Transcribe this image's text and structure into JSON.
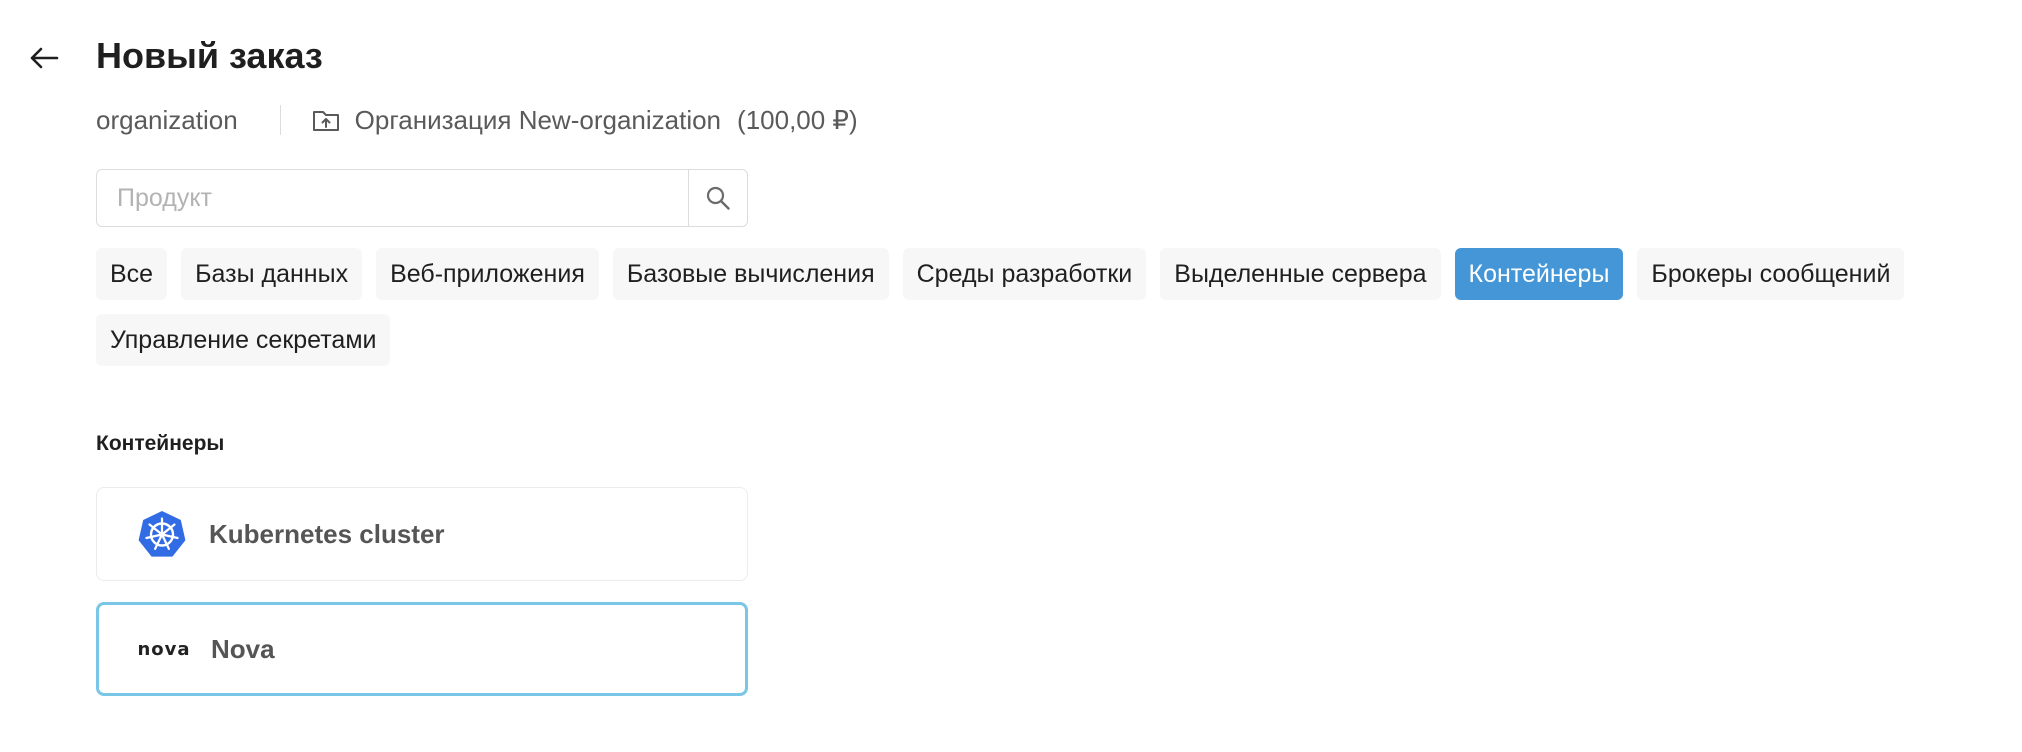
{
  "header": {
    "title": "Новый заказ",
    "back_icon": "arrow-left-icon"
  },
  "context": {
    "scope": "organization",
    "org_icon": "folder-upload-icon",
    "org_name": "Организация New-organization",
    "balance": "(100,00 ₽)"
  },
  "search": {
    "placeholder": "Продукт",
    "value": "",
    "icon": "search-icon"
  },
  "categories": [
    {
      "label": "Все",
      "active": false
    },
    {
      "label": "Базы данных",
      "active": false
    },
    {
      "label": "Веб-приложения",
      "active": false
    },
    {
      "label": "Базовые вычисления",
      "active": false
    },
    {
      "label": "Среды разработки",
      "active": false
    },
    {
      "label": "Выделенные сервера",
      "active": false
    },
    {
      "label": "Контейнеры",
      "active": true
    },
    {
      "label": "Брокеры сообщений",
      "active": false
    },
    {
      "label": "Управление секретами",
      "active": false
    }
  ],
  "section": {
    "title": "Контейнеры",
    "products": [
      {
        "name": "Kubernetes cluster",
        "icon": "kubernetes-icon"
      },
      {
        "name": "Nova",
        "logo_text": "nova",
        "icon": "nova-logo"
      }
    ]
  },
  "colors": {
    "active_chip": "#4496d6",
    "chip_bg": "#f7f7f7",
    "selected_card_border": "#79c6e6",
    "kubernetes_blue": "#326ce5"
  }
}
